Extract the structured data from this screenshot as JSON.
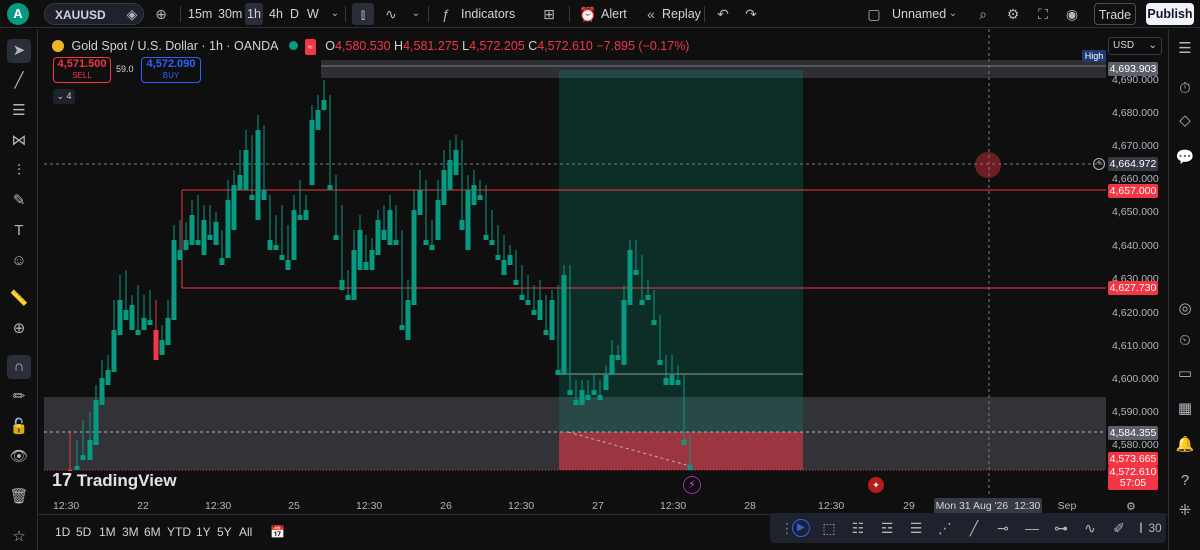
{
  "topbar": {
    "avatar_letter": "A",
    "symbol": "XAUUSD",
    "timeframes": [
      "15m",
      "30m",
      "1h",
      "4h",
      "D",
      "W"
    ],
    "active_timeframe": "1h",
    "indicators_label": "Indicators",
    "alert_label": "Alert",
    "replay_label": "Replay",
    "layout_name": "Unnamed",
    "trade_label": "Trade",
    "publish_label": "Publish"
  },
  "legend": {
    "title": "Gold Spot / U.S. Dollar · 1h · OANDA",
    "o_label": "O",
    "o_value": "4,580.530",
    "h_label": "H",
    "h_value": "4,581.275",
    "l_label": "L",
    "l_value": "4,572.205",
    "c_label": "C",
    "c_value": "4,572.610",
    "change": "−7.895 (−0.17%)",
    "sell_price": "4,571.500",
    "sell_label": "SELL",
    "spread": "59.0",
    "buy_price": "4,572.090",
    "buy_label": "BUY",
    "collapsed_count": "4"
  },
  "price_axis": {
    "currency": "USD",
    "high_tag": "High",
    "ticks": [
      "4,690.000",
      "4,680.000",
      "4,670.000",
      "4,660.000",
      "4,650.000",
      "4,640.000",
      "4,630.000",
      "4,620.000",
      "4,610.000",
      "4,600.000",
      "4,590.000",
      "4,580.000"
    ],
    "labels": {
      "high": "4,693.903",
      "crosshair": "4,664.972",
      "upper_line": "4,657.000",
      "lower_line": "4,627.730",
      "dashed": "4,584.355",
      "stop": "4,573.665",
      "last": "4,572.610",
      "countdown": "57:05"
    }
  },
  "time_axis": {
    "labels": [
      "12:30",
      "22",
      "12:30",
      "25",
      "12:30",
      "26",
      "12:30",
      "27",
      "12:30",
      "28",
      "12:30",
      "29",
      "Sep"
    ],
    "crosshair_date": "Mon 31 Aug '26",
    "crosshair_time": "12:30"
  },
  "bottombar": {
    "ranges": [
      "1D",
      "5D",
      "1M",
      "3M",
      "6M",
      "YTD",
      "1Y",
      "5Y",
      "All"
    ],
    "draw_count": "30"
  },
  "brand": "TradingView",
  "colors": {
    "up": "#089981",
    "down": "#f23645",
    "line": "#f23645",
    "accent": "#2962ff"
  },
  "chart_data": {
    "type": "candlestick",
    "symbol": "XAUUSD",
    "interval": "1h",
    "ylim": [
      4575,
      4695
    ],
    "horizontal_levels": [
      4657.0,
      4627.73
    ],
    "high": 4693.903,
    "last": 4572.61
  }
}
